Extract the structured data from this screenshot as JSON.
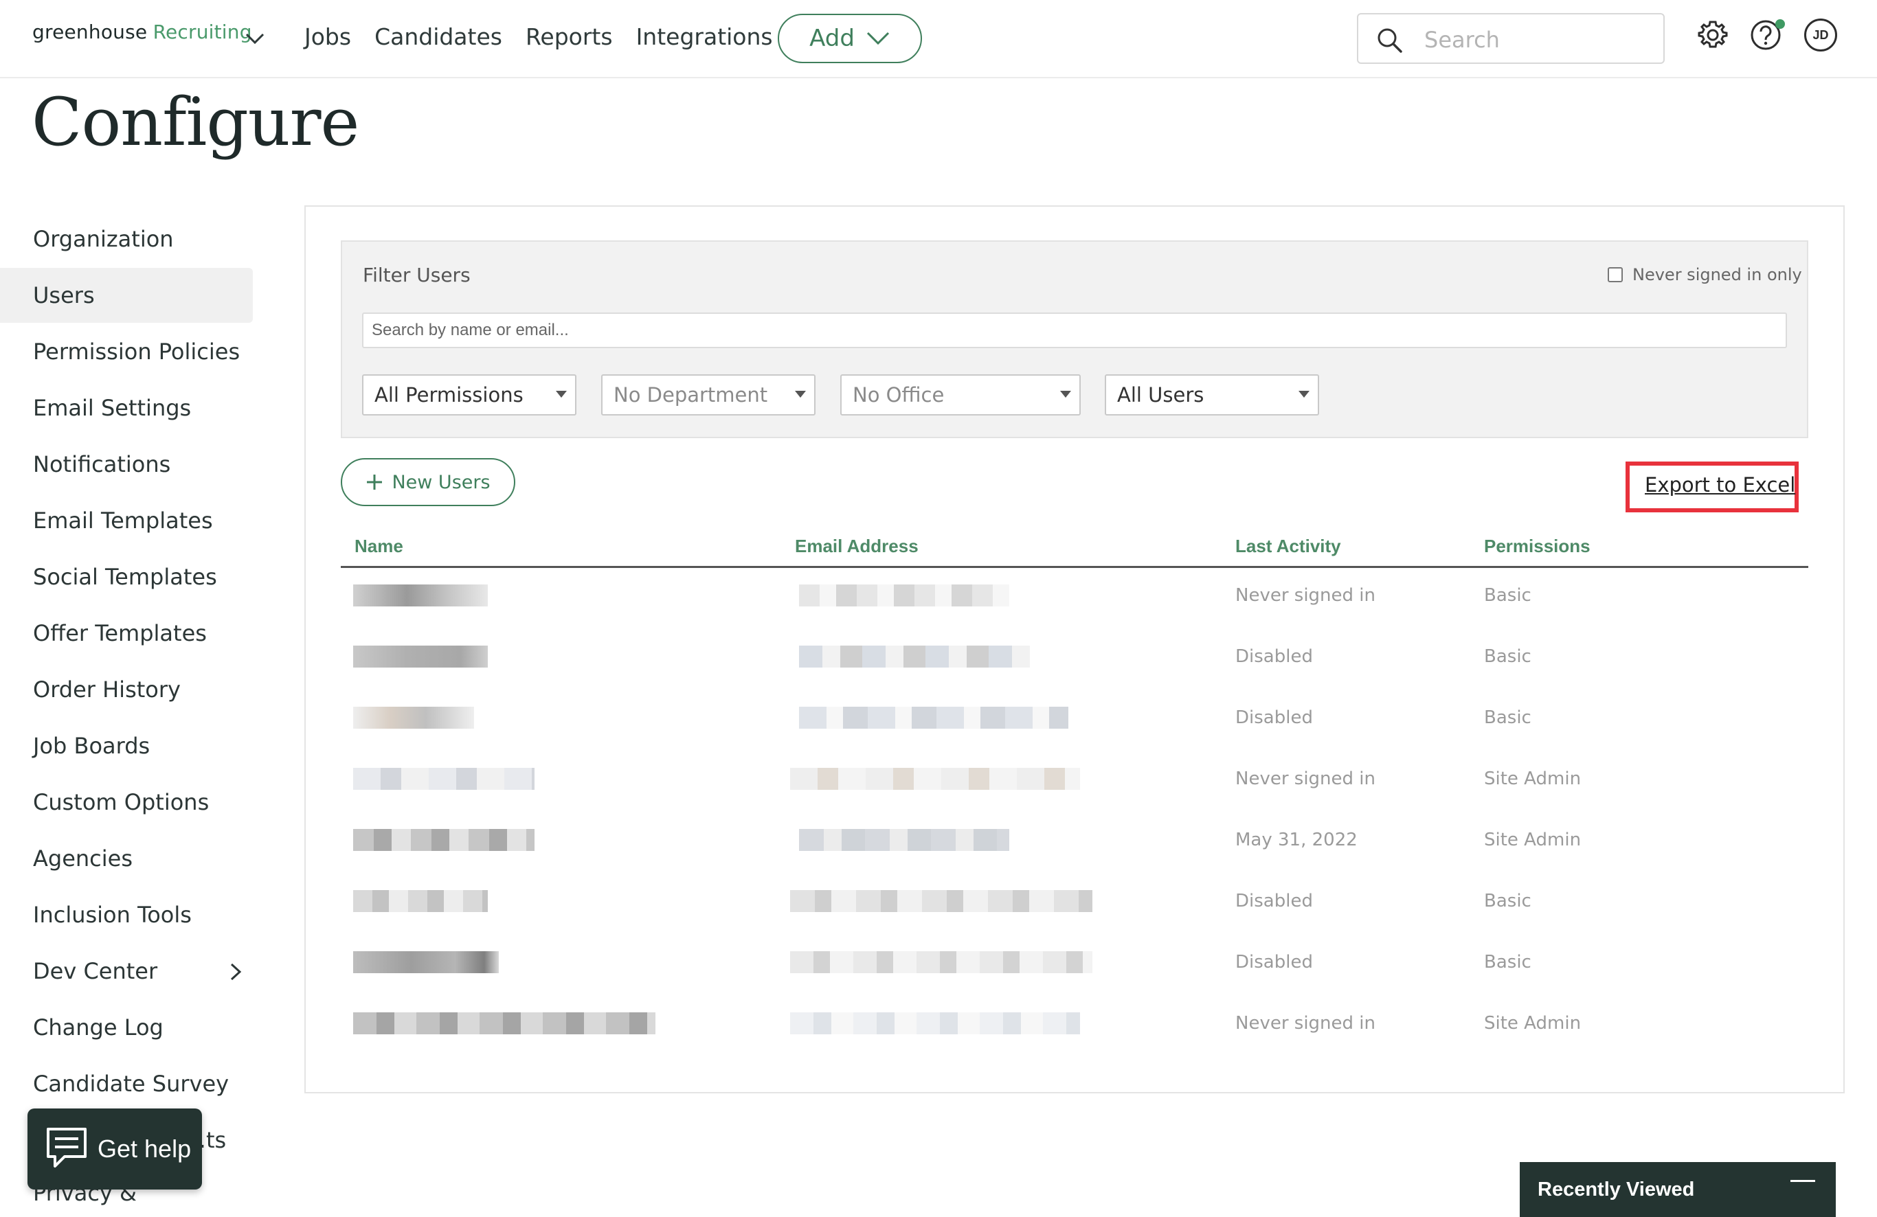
{
  "brand": {
    "name_part1": "greenhouse",
    "name_part2": "Recruiting"
  },
  "nav": {
    "items": [
      "Jobs",
      "Candidates",
      "Reports",
      "Integrations"
    ],
    "add_label": "Add"
  },
  "search": {
    "placeholder": "Search"
  },
  "user": {
    "initials": "JD"
  },
  "page": {
    "title": "Configure"
  },
  "sidebar": {
    "items": [
      {
        "label": "Organization"
      },
      {
        "label": "Users",
        "active": true
      },
      {
        "label": "Permission Policies"
      },
      {
        "label": "Email Settings"
      },
      {
        "label": "Notifications"
      },
      {
        "label": "Email Templates"
      },
      {
        "label": "Social Templates"
      },
      {
        "label": "Offer Templates"
      },
      {
        "label": "Order History"
      },
      {
        "label": "Job Boards"
      },
      {
        "label": "Custom Options"
      },
      {
        "label": "Agencies"
      },
      {
        "label": "Inclusion Tools"
      },
      {
        "label": "Dev Center",
        "has_submenu": true
      },
      {
        "label": "Change Log"
      },
      {
        "label": "Candidate Survey"
      },
      {
        "label": "…ts"
      },
      {
        "label": "Privacy &"
      }
    ]
  },
  "filters": {
    "title": "Filter Users",
    "never_signed_in_label": "Never signed in only",
    "never_signed_in_checked": false,
    "search_placeholder": "Search by name or email...",
    "selects": {
      "permissions": "All Permissions",
      "department": "No Department",
      "office": "No Office",
      "users": "All Users"
    }
  },
  "actions": {
    "new_users_label": "New Users",
    "export_label": "Export to Excel"
  },
  "table": {
    "columns": {
      "name": "Name",
      "email": "Email Address",
      "last_activity": "Last Activity",
      "permissions": "Permissions"
    },
    "rows": [
      {
        "last_activity": "Never signed in",
        "permission": "Basic"
      },
      {
        "last_activity": "Disabled",
        "permission": "Basic"
      },
      {
        "last_activity": "Disabled",
        "permission": "Basic"
      },
      {
        "last_activity": "Never signed in",
        "permission": "Site Admin"
      },
      {
        "last_activity": "May 31, 2022",
        "permission": "Site Admin"
      },
      {
        "last_activity": "Disabled",
        "permission": "Basic"
      },
      {
        "last_activity": "Disabled",
        "permission": "Basic"
      },
      {
        "last_activity": "Never signed in",
        "permission": "Site Admin"
      }
    ]
  },
  "widgets": {
    "get_help_label": "Get help",
    "recently_viewed_label": "Recently Viewed"
  },
  "colors": {
    "brand_green": "#3f7f5c",
    "header_text_green": "#4e8a67",
    "highlight_red": "#e8323c",
    "dark_widget": "#243431"
  }
}
